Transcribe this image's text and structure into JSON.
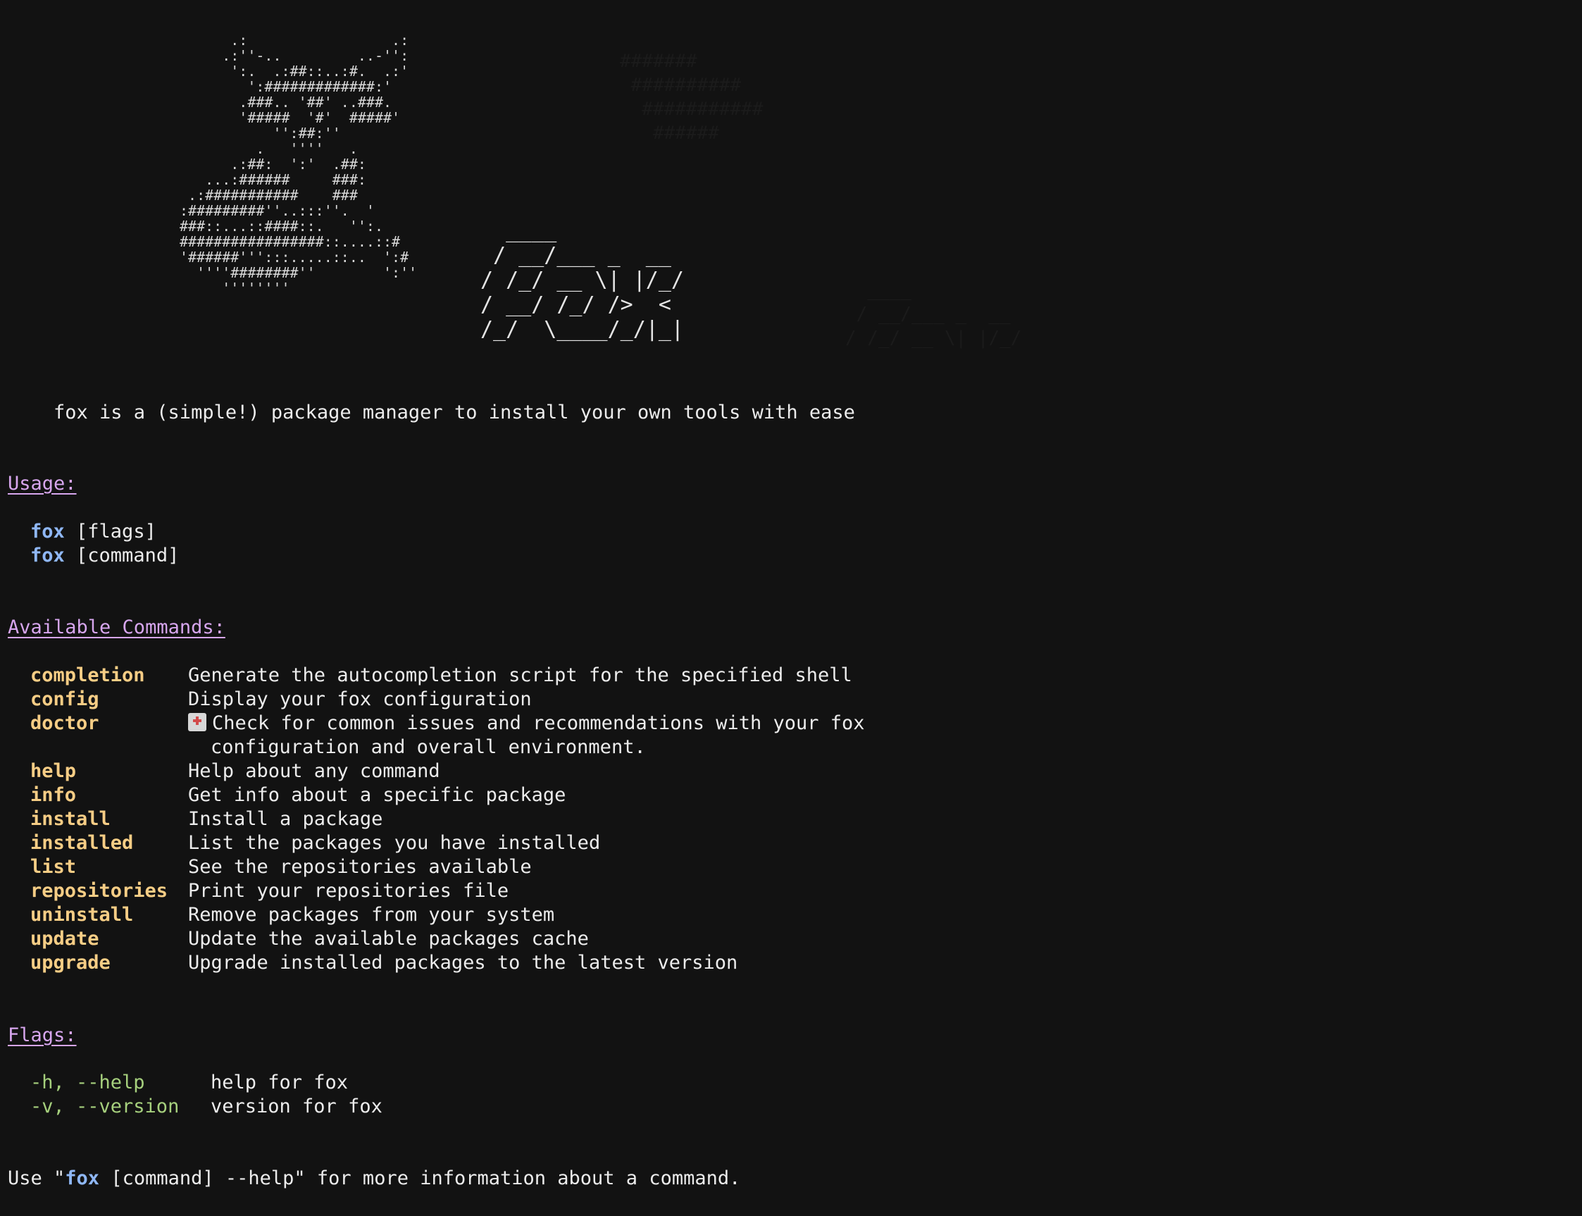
{
  "ascii_art": {
    "fox": "      .:                 .:\n     .:''-..         ..-'':\n      ':.  .:##::..:#.  .:'\n        ':#############:'\n       .###.. '##' ..###.\n       '#####  '#'  #####'\n           '':##:''\n         .   ''''   .\n      .:##:  ':'  .##:\n   ...:######     ###:\n .:###########    ###\n:#########''..:::''.  '\n###::...::####::.   '':.\n#################::....::#\n'######''':::.....::..  ':#\n  ''''########''        ':''\n     ''''''''",
    "name": "  ____\n / __/___ _  __\n/ /_/ __ \\| |/_/\n/ __/ /_/ />  <\n/_/  \\____/_/|_|"
  },
  "tagline": "fox is a (simple!) package manager to install your own tools with ease",
  "usage": {
    "heading": "Usage:",
    "lines": [
      {
        "prog": "fox",
        "args": " [flags]"
      },
      {
        "prog": "fox",
        "args": " [command]"
      }
    ]
  },
  "commands": {
    "heading": "Available Commands:",
    "items": [
      {
        "name": "completion",
        "desc": "Generate the autocompletion script for the specified shell"
      },
      {
        "name": "config",
        "desc": "Display your fox configuration"
      },
      {
        "name": "doctor",
        "icon": "medical-kit-icon",
        "desc": "Check for common issues and recommendations with your fox",
        "desc2": "configuration and overall environment."
      },
      {
        "name": "help",
        "desc": "Help about any command"
      },
      {
        "name": "info",
        "desc": "Get info about a specific package"
      },
      {
        "name": "install",
        "desc": "Install a package"
      },
      {
        "name": "installed",
        "desc": "List the packages you have installed"
      },
      {
        "name": "list",
        "desc": "See the repositories available"
      },
      {
        "name": "repositories",
        "desc": "Print your repositories file"
      },
      {
        "name": "uninstall",
        "desc": "Remove packages from your system"
      },
      {
        "name": "update",
        "desc": "Update the available packages cache"
      },
      {
        "name": "upgrade",
        "desc": "Upgrade installed packages to the latest version"
      }
    ]
  },
  "flags": {
    "heading": "Flags:",
    "items": [
      {
        "flag": "-h, --help",
        "desc": "help for fox"
      },
      {
        "flag": "-v, --version",
        "desc": "version for fox"
      }
    ]
  },
  "footer": {
    "before": "Use \"",
    "prog": "fox",
    "after": " [command] --help\" for more information about a command."
  },
  "colors": {
    "background": "#121212",
    "text": "#ececec",
    "heading": "#d7a6ee",
    "command": "#f6cd85",
    "program": "#8fb7f5",
    "flag": "#a6d07d"
  }
}
